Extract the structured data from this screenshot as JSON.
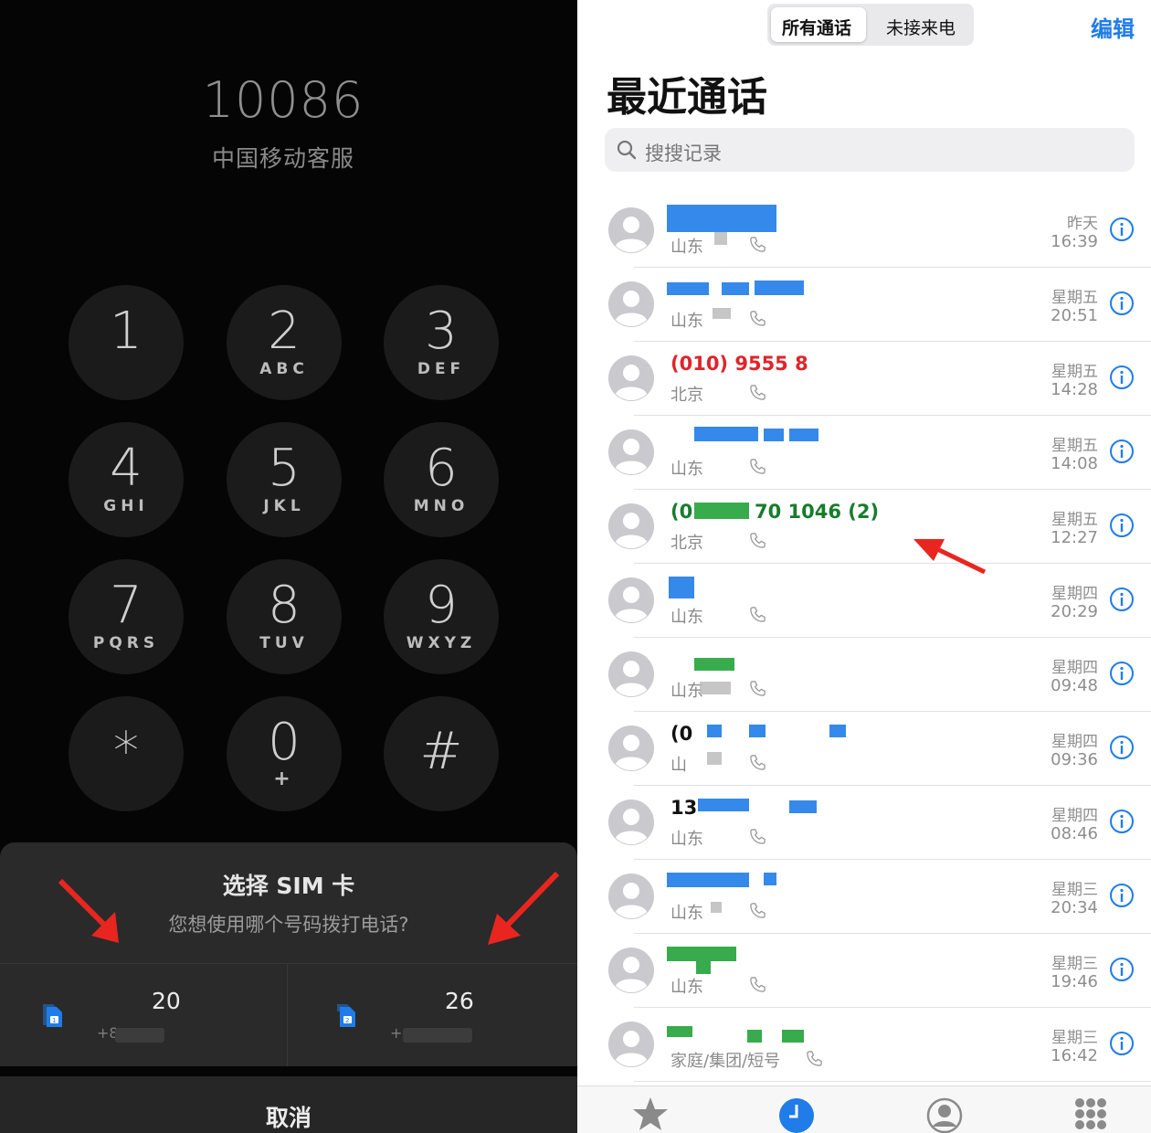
{
  "dialer": {
    "number": "10086",
    "caller_name": "中国移动客服",
    "keys": [
      {
        "digit": "1",
        "letters": ""
      },
      {
        "digit": "2",
        "letters": "ABC"
      },
      {
        "digit": "3",
        "letters": "DEF"
      },
      {
        "digit": "4",
        "letters": "GHI"
      },
      {
        "digit": "5",
        "letters": "JKL"
      },
      {
        "digit": "6",
        "letters": "MNO"
      },
      {
        "digit": "7",
        "letters": "PQRS"
      },
      {
        "digit": "8",
        "letters": "TUV"
      },
      {
        "digit": "9",
        "letters": "WXYZ"
      },
      {
        "digit": "*",
        "letters": ""
      },
      {
        "digit": "0",
        "letters": "+"
      },
      {
        "digit": "#",
        "letters": ""
      }
    ]
  },
  "sim_sheet": {
    "title": "选择 SIM 卡",
    "subtitle": "您想使用哪个号码拨打电话?",
    "options": [
      {
        "number": "20",
        "sub": "+8"
      },
      {
        "number": "26",
        "sub": "+"
      }
    ],
    "cancel": "取消"
  },
  "recents": {
    "segments": [
      "所有通话",
      "未接来电"
    ],
    "edit": "编辑",
    "title": "最近通话",
    "search_placeholder": "搜搜记录",
    "calls": [
      {
        "name": "",
        "location": "山东",
        "day": "昨天",
        "time": "16:39",
        "color": "blue"
      },
      {
        "name": "",
        "location": "山东",
        "day": "星期五",
        "time": "20:51",
        "color": "blue"
      },
      {
        "name": "(010) 9555 8",
        "location": "北京",
        "day": "星期五",
        "time": "14:28",
        "color": "red"
      },
      {
        "name": "",
        "location": "山东",
        "day": "星期五",
        "time": "14:08",
        "color": "blue"
      },
      {
        "name": "(0",
        "name2": "70 1046 (2)",
        "location": "北京",
        "day": "星期五",
        "time": "12:27",
        "color": "green"
      },
      {
        "name": "",
        "location": "山东",
        "day": "星期四",
        "time": "20:29",
        "color": "blue"
      },
      {
        "name": "",
        "location": "山东",
        "day": "星期四",
        "time": "09:48",
        "color": "green"
      },
      {
        "name": "(0",
        "location": "山",
        "day": "星期四",
        "time": "09:36",
        "color": "blue"
      },
      {
        "name": "13",
        "location": "山东",
        "day": "星期四",
        "time": "08:46",
        "color": "blue"
      },
      {
        "name": "",
        "location": "山东",
        "day": "星期三",
        "time": "20:34",
        "color": "blue"
      },
      {
        "name": "",
        "location": "山东",
        "day": "星期三",
        "time": "19:46",
        "color": "green"
      },
      {
        "name": "",
        "location": "家庭/集团/短号",
        "day": "星期三",
        "time": "16:42",
        "color": "green"
      }
    ],
    "tabs": [
      "star-icon",
      "clock-icon",
      "person-icon",
      "keypad-icon"
    ],
    "accent_color": "#1f7ce8"
  }
}
